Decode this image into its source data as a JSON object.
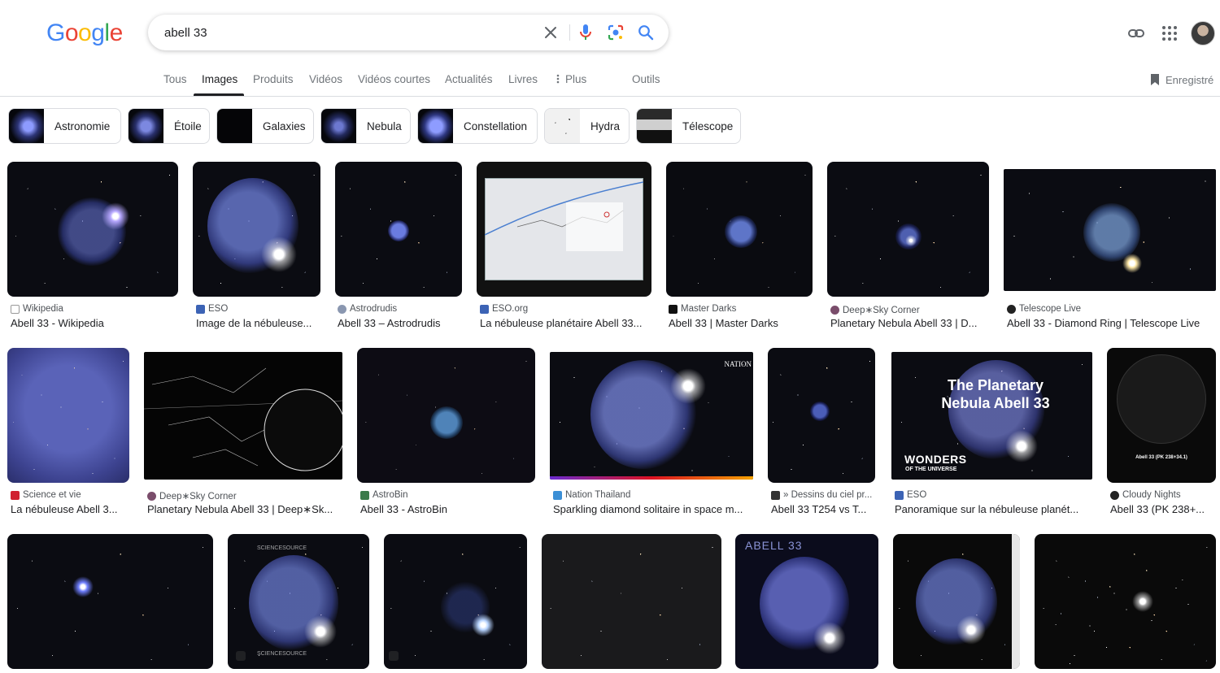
{
  "header": {
    "search_value": "abell 33",
    "logo": [
      "G",
      "o",
      "o",
      "g",
      "l",
      "e"
    ],
    "logo_colors": [
      "#4285F4",
      "#EA4335",
      "#FBBC05",
      "#4285F4",
      "#34A853",
      "#EA4335"
    ]
  },
  "tabs": [
    {
      "label": "Tous"
    },
    {
      "label": "Images"
    },
    {
      "label": "Produits"
    },
    {
      "label": "Vidéos"
    },
    {
      "label": "Vidéos courtes"
    },
    {
      "label": "Actualités"
    },
    {
      "label": "Livres"
    },
    {
      "label": "Plus"
    },
    {
      "label": "Outils"
    }
  ],
  "saved_label": "Enregistré",
  "chips": [
    {
      "label": "Astronomie"
    },
    {
      "label": "Étoile"
    },
    {
      "label": "Galaxies"
    },
    {
      "label": "Nebula"
    },
    {
      "label": "Constellation"
    },
    {
      "label": "Hydra"
    },
    {
      "label": "Télescope"
    }
  ],
  "results": [
    {
      "source": "Wikipedia",
      "title": "Abell 33 - Wikipedia"
    },
    {
      "source": "ESO",
      "title": "Image de la nébuleuse..."
    },
    {
      "source": "Astrodrudis",
      "title": "Abell 33 – Astrodrudis"
    },
    {
      "source": "ESO.org",
      "title": "La nébuleuse planétaire Abell 33..."
    },
    {
      "source": "Master Darks",
      "title": "Abell 33 | Master Darks"
    },
    {
      "source": "Deep∗Sky Corner",
      "title": "Planetary Nebula Abell 33 | D..."
    },
    {
      "source": "Telescope Live",
      "title": "Abell 33 - Diamond Ring | Telescope Live"
    },
    {
      "source": "Science et vie",
      "title": "La nébuleuse Abell 3..."
    },
    {
      "source": "Deep∗Sky Corner",
      "title": "Planetary Nebula Abell 33 | Deep∗Sk..."
    },
    {
      "source": "AstroBin",
      "title": "Abell 33 - AstroBin"
    },
    {
      "source": "Nation Thailand",
      "title": "Sparkling diamond solitaire in space m..."
    },
    {
      "source": "» Dessins du ciel pr...",
      "title": "Abell 33 T254 vs T..."
    },
    {
      "source": "ESO",
      "title": "Panoramique sur la nébuleuse planét..."
    },
    {
      "source": "Cloudy Nights",
      "title": "Abell 33 (PK 238+..."
    }
  ],
  "overlays": {
    "planetary_title": "The Planetary Nebula Abell 33",
    "wonders": "WONDERS",
    "wonders_sub": "OF THE UNIVERSE",
    "abell33_banner": "ABELL 33",
    "sciencesource": "SCIENCESOURCE",
    "nation": "NATION",
    "cloudy_caption": "Abell 33 (PK 238+34.1)"
  },
  "colors": {
    "accent_blue": "#1a73e8",
    "text_primary": "#202124",
    "text_secondary": "#70757a",
    "nebula_blue": "#6b78d6"
  },
  "icons": [
    "clear-icon",
    "mic-icon",
    "lens-icon",
    "search-icon",
    "link-icon",
    "apps-icon",
    "bookmark-icon",
    "more-dots-icon"
  ]
}
